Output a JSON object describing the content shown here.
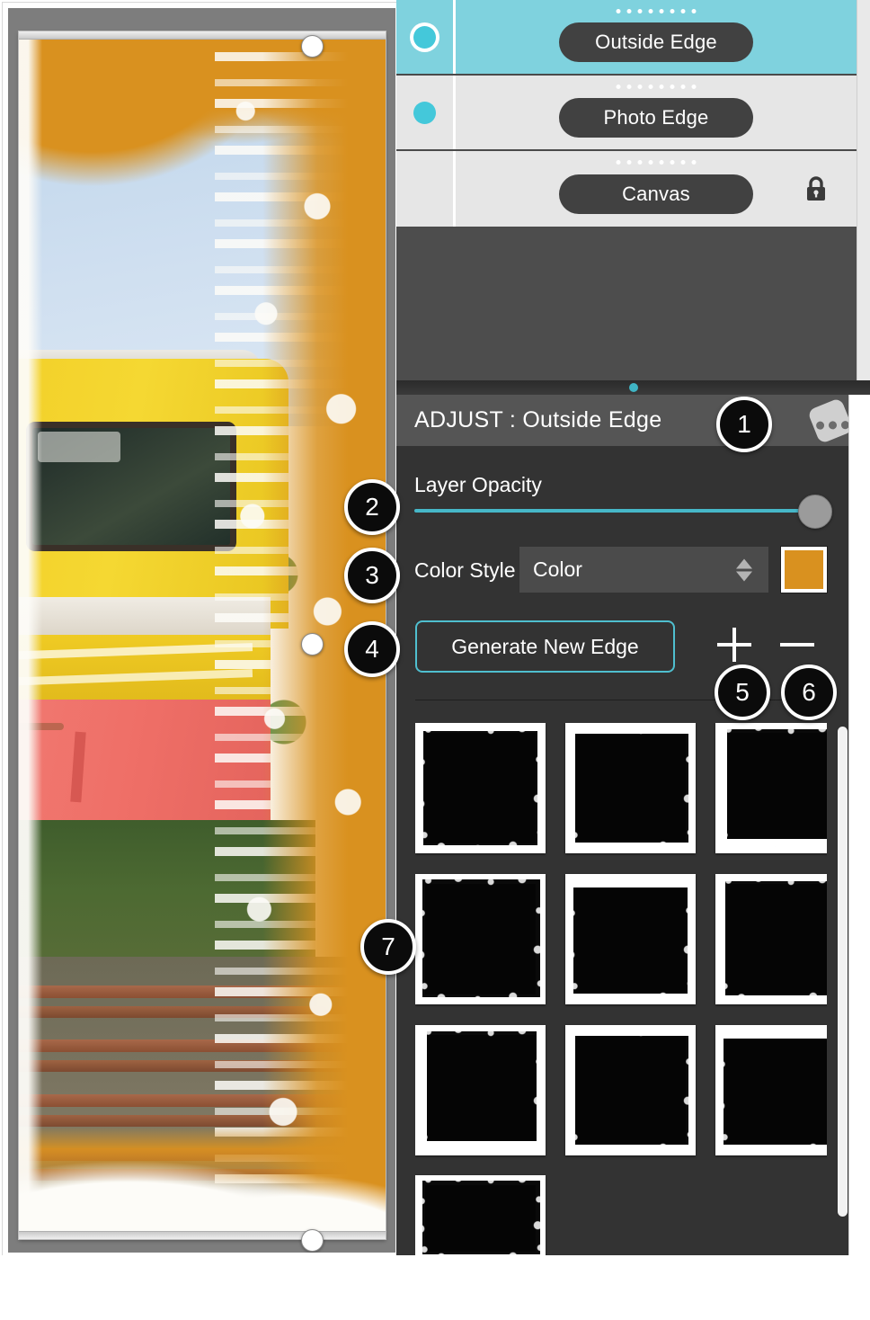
{
  "app": {
    "canvas_bg": "#7d7d7d",
    "accent_teal": "#44c8da",
    "accent_orange": "#d9911f",
    "panel_bg": "#333333"
  },
  "layers": {
    "items": [
      {
        "name": "Outside Edge",
        "visible": true,
        "selected": true,
        "locked": false,
        "lock_icon": "lock-icon",
        "handle_icon": "drag-dots-icon",
        "visibility_icon": "visibility-dot-icon"
      },
      {
        "name": "Photo Edge",
        "visible": true,
        "selected": false,
        "locked": false,
        "lock_icon": "",
        "handle_icon": "drag-dots-icon",
        "visibility_icon": "visibility-dot-icon"
      },
      {
        "name": "Canvas",
        "visible": false,
        "selected": false,
        "locked": true,
        "lock_icon": "lock-icon",
        "handle_icon": "drag-dots-icon",
        "visibility_icon": ""
      }
    ]
  },
  "splitter": {
    "handle_icon": "splitter-dot-icon"
  },
  "adjust": {
    "title": "ADJUST : Outside Edge",
    "menu_icon": "dice-menu-icon",
    "opacity": {
      "label": "Layer Opacity",
      "value": 100,
      "min": 0,
      "max": 100
    },
    "color_style": {
      "label": "Color Style",
      "value": "Color",
      "options": [
        "Color"
      ],
      "stepper_icon": "stepper-arrows-icon",
      "swatch_color": "#d9911f",
      "swatch_name": "color-swatch"
    },
    "generate_button": "Generate New Edge",
    "add_button_icon": "plus-icon",
    "remove_button_icon": "minus-icon"
  },
  "thumbnails": {
    "count": 10,
    "label": "edge-texture-thumbnail",
    "items": [
      {
        "id": 1
      },
      {
        "id": 2
      },
      {
        "id": 3
      },
      {
        "id": 4
      },
      {
        "id": 5
      },
      {
        "id": 6
      },
      {
        "id": 7
      },
      {
        "id": 8
      },
      {
        "id": 9
      },
      {
        "id": 10
      }
    ]
  },
  "scrollbar": {
    "name": "thumbnail-scrollbar"
  },
  "canvas": {
    "image_description": "Abandoned yellow and red train car on rusted tracks with orange grunge edge effect",
    "handles": [
      "top-right",
      "middle-right",
      "bottom-right"
    ]
  },
  "callouts": [
    {
      "number": "1"
    },
    {
      "number": "2"
    },
    {
      "number": "3"
    },
    {
      "number": "4"
    },
    {
      "number": "5"
    },
    {
      "number": "6"
    },
    {
      "number": "7"
    }
  ]
}
